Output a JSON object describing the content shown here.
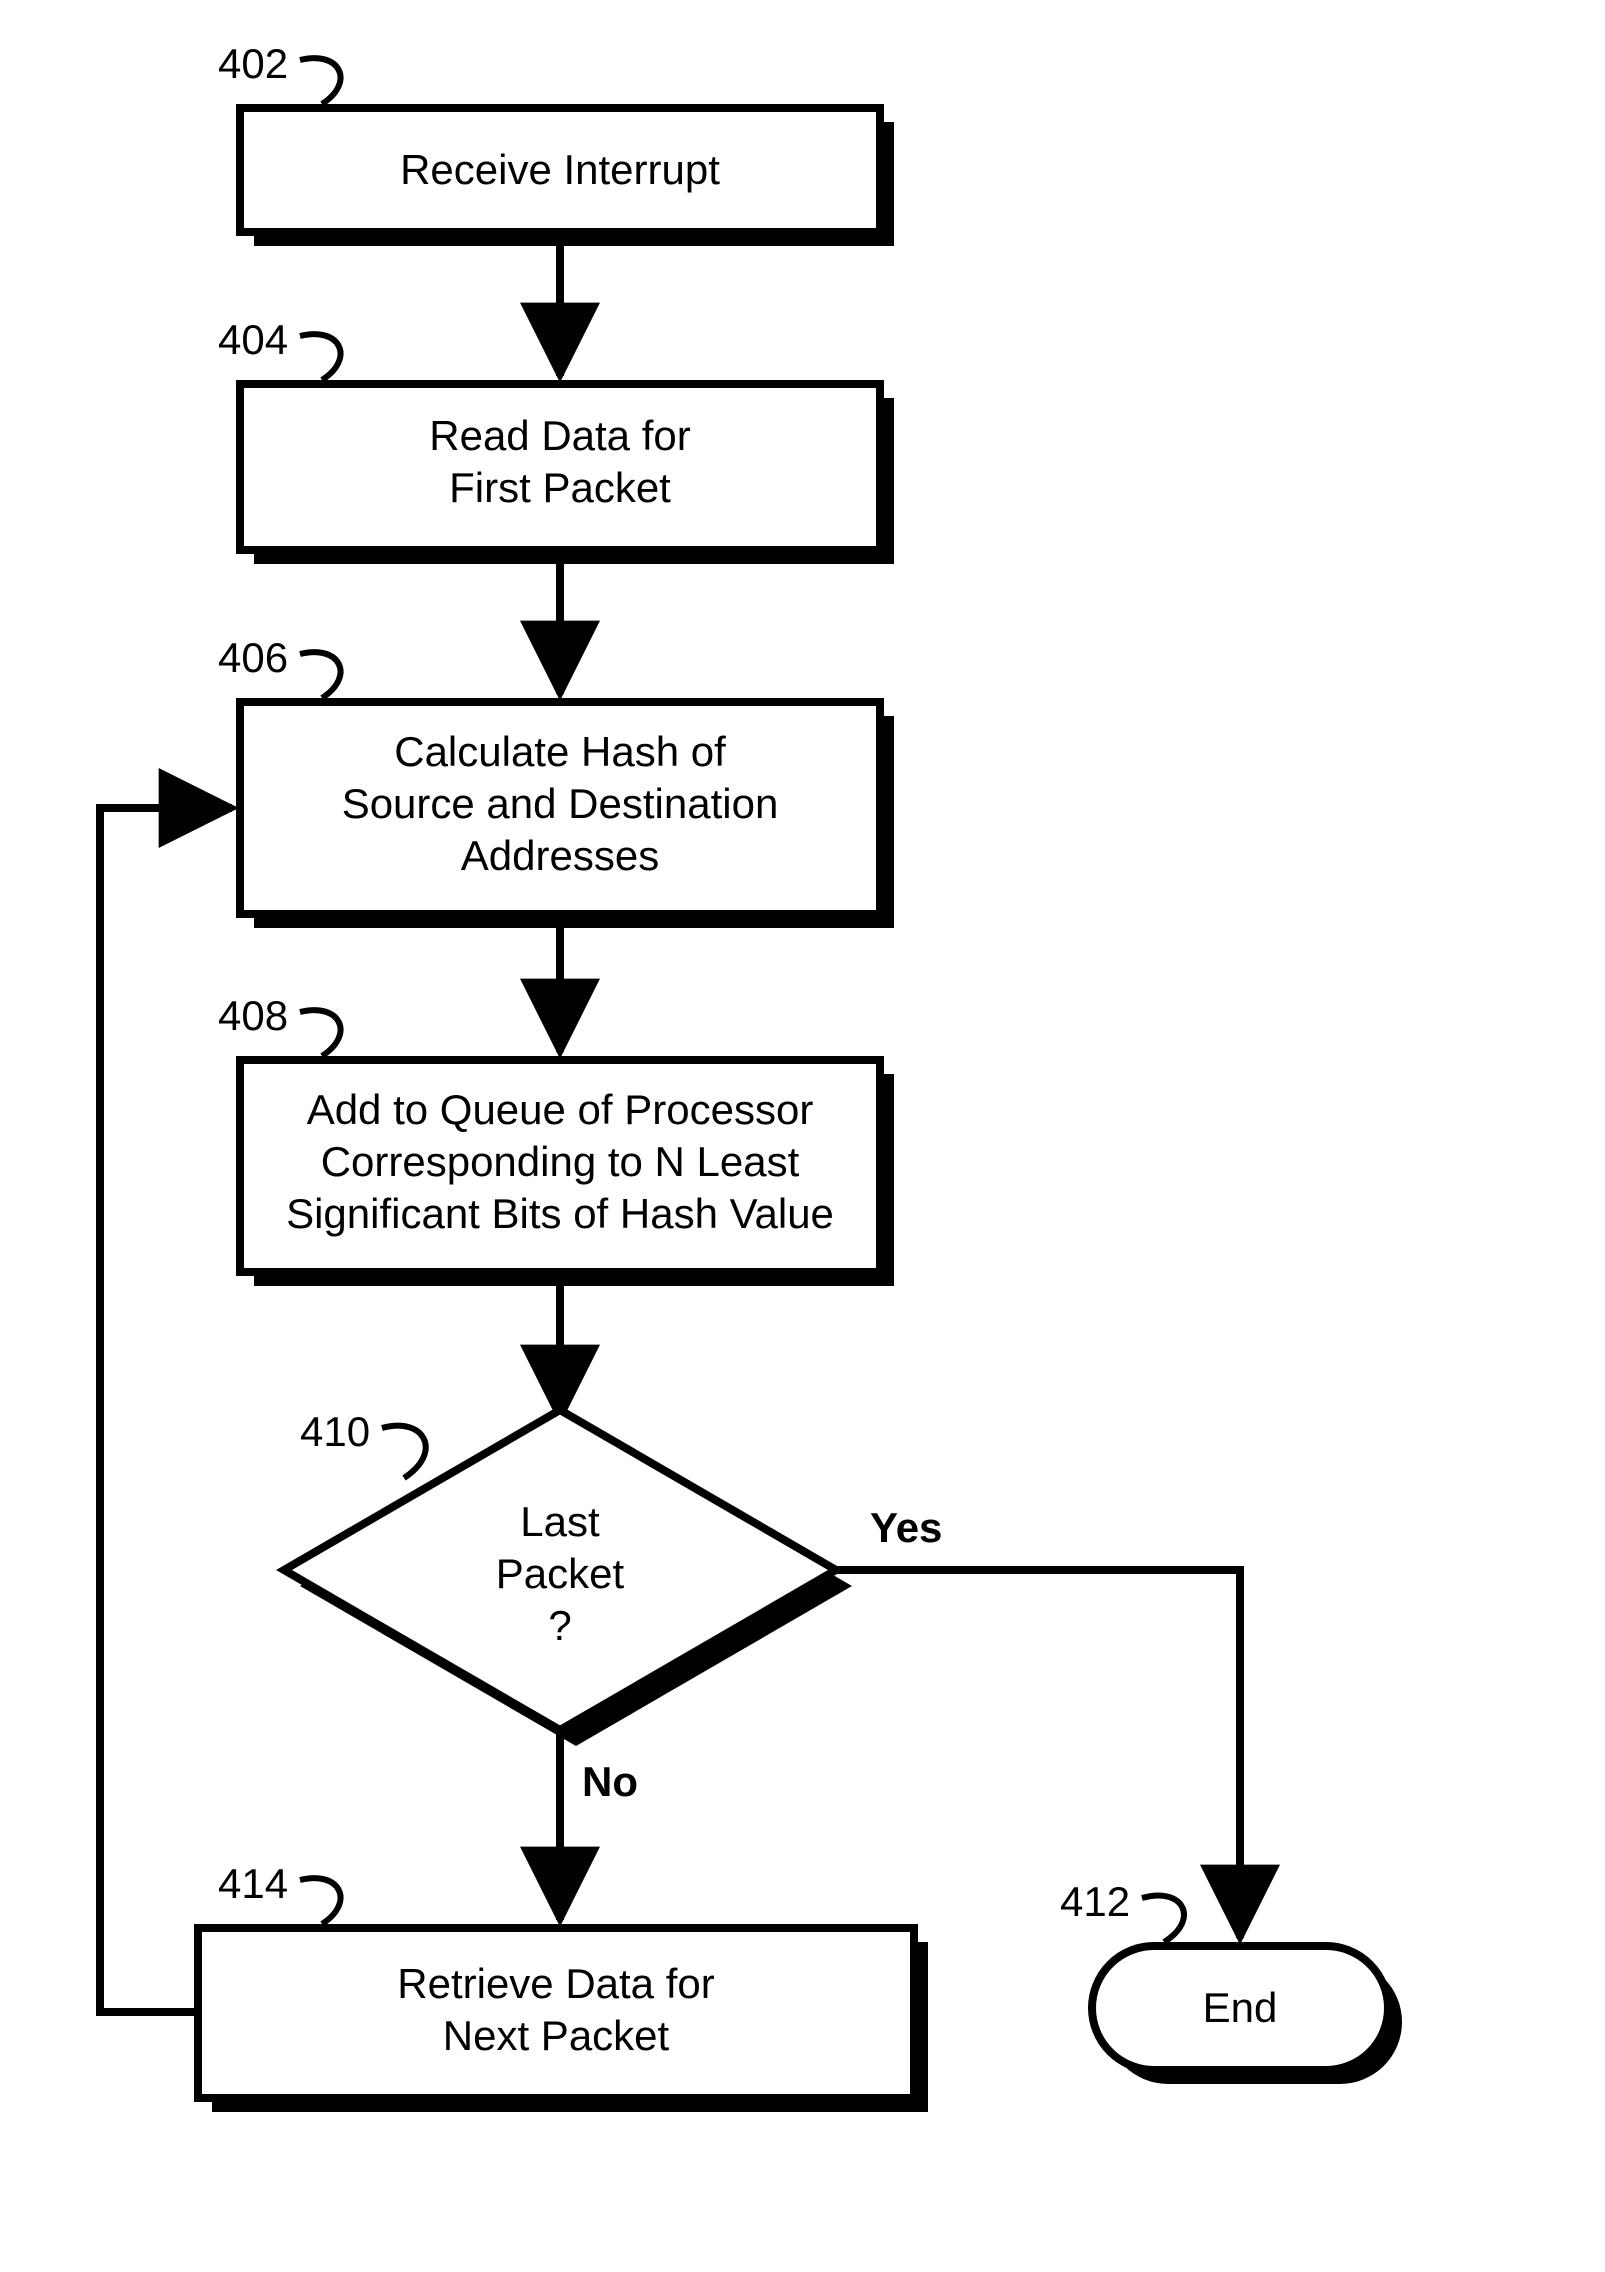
{
  "refs": {
    "r402": "402",
    "r404": "404",
    "r406": "406",
    "r408": "408",
    "r410": "410",
    "r412": "412",
    "r414": "414"
  },
  "nodes": {
    "n402": {
      "line1": "Receive Interrupt"
    },
    "n404": {
      "line1": "Read Data for",
      "line2": "First Packet"
    },
    "n406": {
      "line1": "Calculate Hash of",
      "line2": "Source and Destination",
      "line3": "Addresses"
    },
    "n408": {
      "line1": "Add to Queue of Processor",
      "line2": "Corresponding to N Least",
      "line3": "Significant Bits of Hash Value"
    },
    "n410": {
      "line1": "Last",
      "line2": "Packet",
      "line3": "?"
    },
    "n412": {
      "line1": "End"
    },
    "n414": {
      "line1": "Retrieve Data for",
      "line2": "Next Packet"
    }
  },
  "edges": {
    "yes": "Yes",
    "no": "No"
  }
}
